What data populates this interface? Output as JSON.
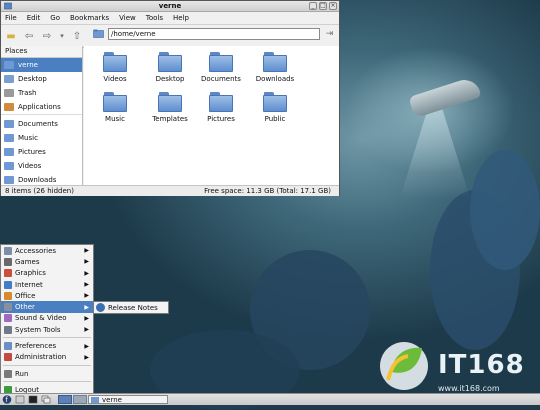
{
  "window": {
    "title": "verne",
    "menu": [
      "File",
      "Edit",
      "Go",
      "Bookmarks",
      "View",
      "Tools",
      "Help"
    ],
    "location": "/home/verne"
  },
  "sidebar": {
    "header": "Places",
    "items": [
      {
        "label": "verne",
        "icon": "home-icon",
        "color": "#6f99d3",
        "selected": true
      },
      {
        "label": "Desktop",
        "icon": "desktop-icon",
        "color": "#7a9fcf"
      },
      {
        "label": "Trash",
        "icon": "trash-icon",
        "color": "#9a9a9a"
      },
      {
        "label": "Applications",
        "icon": "applications-icon",
        "color": "#d08b3c"
      },
      {
        "label": "Documents",
        "icon": "folder-icon",
        "color": "#6f99d3"
      },
      {
        "label": "Music",
        "icon": "folder-icon",
        "color": "#6f99d3"
      },
      {
        "label": "Pictures",
        "icon": "folder-icon",
        "color": "#6f99d3"
      },
      {
        "label": "Videos",
        "icon": "folder-icon",
        "color": "#6f99d3"
      },
      {
        "label": "Downloads",
        "icon": "folder-icon",
        "color": "#6f99d3"
      }
    ]
  },
  "files": [
    {
      "label": "Videos"
    },
    {
      "label": "Desktop"
    },
    {
      "label": "Documents"
    },
    {
      "label": "Downloads"
    },
    {
      "label": "Music"
    },
    {
      "label": "Templates"
    },
    {
      "label": "Pictures"
    },
    {
      "label": "Public"
    }
  ],
  "status": {
    "left": "8 items (26 hidden)",
    "right": "Free space: 11.3 GB (Total: 17.1 GB)"
  },
  "start_menu": {
    "items": [
      {
        "label": "Accessories",
        "submenu": true,
        "icon": "accessories-icon",
        "color": "#7b8fa8"
      },
      {
        "label": "Games",
        "submenu": true,
        "icon": "games-icon",
        "color": "#6a6a6a"
      },
      {
        "label": "Graphics",
        "submenu": true,
        "icon": "graphics-icon",
        "color": "#c9503c"
      },
      {
        "label": "Internet",
        "submenu": true,
        "icon": "internet-icon",
        "color": "#3f7ec6"
      },
      {
        "label": "Office",
        "submenu": true,
        "icon": "office-icon",
        "color": "#d88a2f"
      },
      {
        "label": "Other",
        "submenu": true,
        "icon": "other-icon",
        "color": "#8a8fa0",
        "highlight": true
      },
      {
        "label": "Sound & Video",
        "submenu": true,
        "icon": "sound-video-icon",
        "color": "#a06ac2"
      },
      {
        "label": "System Tools",
        "submenu": true,
        "icon": "system-tools-icon",
        "color": "#6f7a86"
      }
    ],
    "items2": [
      {
        "label": "Preferences",
        "submenu": true,
        "icon": "preferences-icon",
        "color": "#6a8fc0"
      },
      {
        "label": "Administration",
        "submenu": true,
        "icon": "administration-icon",
        "color": "#c24a3e"
      }
    ],
    "items3": [
      {
        "label": "Run",
        "icon": "run-icon",
        "color": "#7a7a7a"
      },
      {
        "label": "Logout",
        "icon": "logout-icon",
        "color": "#3c9b3c"
      }
    ],
    "submenu_item": "Release Notes"
  },
  "taskbar": {
    "task_label": "verne"
  },
  "logo": {
    "text": "IT168",
    "url": "www.it168.com"
  }
}
